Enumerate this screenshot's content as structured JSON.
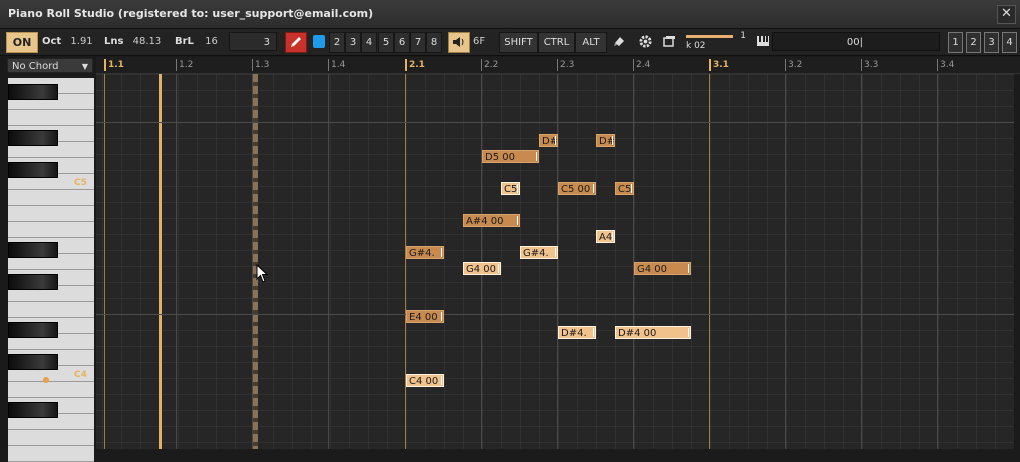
{
  "window": {
    "title": "Piano Roll Studio  (registered to: user_support@email.com)",
    "close_glyph": "✕"
  },
  "toolbar": {
    "on_label": "ON",
    "oct_label": "Oct",
    "oct_value": "1.91",
    "lns_label": "Lns",
    "lns_value": "48.13",
    "brl_label": "BrL",
    "brl_value": "16",
    "num_value": "3",
    "pencil_icon": "pencil-icon",
    "channels": [
      "2",
      "3",
      "4",
      "5",
      "6",
      "7",
      "8"
    ],
    "speaker_icon": "speaker-icon",
    "volume_value": "6F",
    "mod_keys": [
      "SHIFT",
      "CTRL",
      "ALT"
    ],
    "tool_icons": [
      "eraser-icon",
      "gear-icon",
      "window-icon"
    ],
    "slider": {
      "name": "k 02",
      "value": "1",
      "level": 0.78
    },
    "piano_icon": "piano-icon",
    "output_value": "00|",
    "tracks": [
      "1",
      "2",
      "3",
      "4"
    ]
  },
  "chord_select": {
    "value": "No Chord"
  },
  "keyboard": {
    "labels": [
      {
        "text": "C5"
      },
      {
        "text": "C4"
      }
    ]
  },
  "ruler": {
    "ticks": [
      "1.1",
      "1.2",
      "1.3",
      "1.4",
      "2.1",
      "2.2",
      "2.3",
      "2.4",
      "3.1",
      "3.2",
      "3.3",
      "3.4"
    ]
  },
  "notes": [
    {
      "label": "D#",
      "style": "dark"
    },
    {
      "label": "D#",
      "style": "dark"
    },
    {
      "label": "D5 00",
      "style": "dark"
    },
    {
      "label": "C5",
      "style": "light"
    },
    {
      "label": "C5 00",
      "style": "dark"
    },
    {
      "label": "C5",
      "style": "dark"
    },
    {
      "label": "A#4 00",
      "style": "dark"
    },
    {
      "label": "A4",
      "style": "light"
    },
    {
      "label": "G#4.",
      "style": "dark"
    },
    {
      "label": "G#4.",
      "style": "light"
    },
    {
      "label": "G4 00",
      "style": "light"
    },
    {
      "label": "G4 00",
      "style": "dark"
    },
    {
      "label": "E4 00",
      "style": "dark"
    },
    {
      "label": "D#4.",
      "style": "light"
    },
    {
      "label": "D#4 00",
      "style": "light"
    },
    {
      "label": "C4 00",
      "style": "light"
    }
  ]
}
